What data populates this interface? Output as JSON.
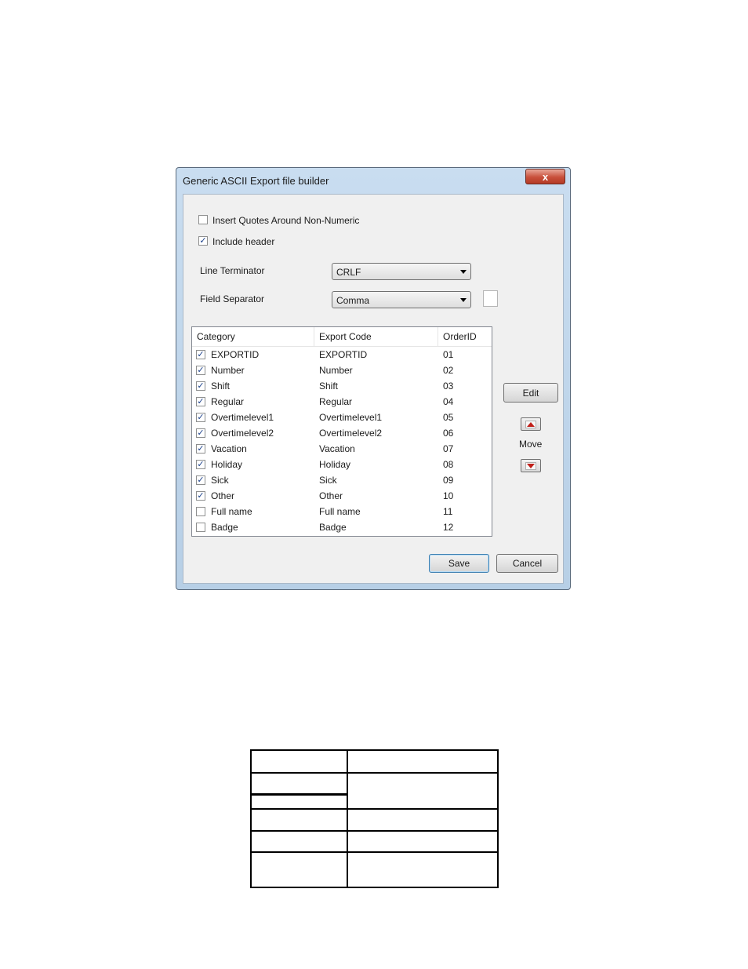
{
  "window": {
    "title": "Generic ASCII Export file builder",
    "close_glyph": "x"
  },
  "options": {
    "insert_quotes": {
      "label": "Insert Quotes Around Non-Numeric",
      "checked": false
    },
    "include_header": {
      "label": "Include header",
      "checked": true
    }
  },
  "line_terminator": {
    "label": "Line Terminator",
    "value": "CRLF"
  },
  "field_separator": {
    "label": "Field Separator",
    "value": "Comma"
  },
  "list": {
    "columns": [
      "Category",
      "Export Code",
      "OrderID"
    ],
    "rows": [
      {
        "checked": true,
        "category": "EXPORTID",
        "code": "EXPORTID",
        "order": "01"
      },
      {
        "checked": true,
        "category": "Number",
        "code": "Number",
        "order": "02"
      },
      {
        "checked": true,
        "category": "Shift",
        "code": "Shift",
        "order": "03"
      },
      {
        "checked": true,
        "category": "Regular",
        "code": "Regular",
        "order": "04"
      },
      {
        "checked": true,
        "category": "Overtimelevel1",
        "code": "Overtimelevel1",
        "order": "05"
      },
      {
        "checked": true,
        "category": "Overtimelevel2",
        "code": "Overtimelevel2",
        "order": "06"
      },
      {
        "checked": true,
        "category": "Vacation",
        "code": "Vacation",
        "order": "07"
      },
      {
        "checked": true,
        "category": "Holiday",
        "code": "Holiday",
        "order": "08"
      },
      {
        "checked": true,
        "category": "Sick",
        "code": "Sick",
        "order": "09"
      },
      {
        "checked": true,
        "category": "Other",
        "code": "Other",
        "order": "10"
      },
      {
        "checked": false,
        "category": "Full name",
        "code": "Full name",
        "order": "11"
      },
      {
        "checked": false,
        "category": "Badge",
        "code": "Badge",
        "order": "12"
      }
    ]
  },
  "buttons": {
    "edit": "Edit",
    "move": "Move",
    "save": "Save",
    "cancel": "Cancel"
  },
  "icons": {
    "move_up": "arrow-up-icon",
    "move_down": "arrow-down-icon",
    "accent_color": "#c0201a"
  }
}
